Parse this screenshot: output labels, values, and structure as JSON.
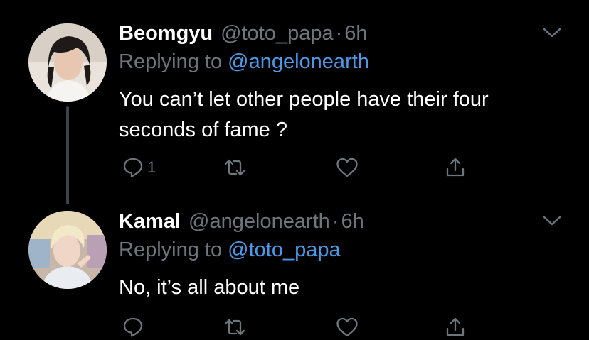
{
  "tweets": [
    {
      "author": {
        "name": "Beomgyu",
        "handle": "@toto_papa",
        "separator": "·",
        "time": "6h",
        "avatar_icon": "avatar-photo"
      },
      "replying_to": {
        "prefix": "Replying to",
        "mention": "@angelonearth"
      },
      "text": "You can’t let other people have their four seconds of fame ?",
      "actions": {
        "reply_count": "1",
        "retweet_count": "",
        "like_count": ""
      }
    },
    {
      "author": {
        "name": "Kamal",
        "handle": "@angelonearth",
        "separator": "·",
        "time": "6h",
        "avatar_icon": "avatar-photo"
      },
      "replying_to": {
        "prefix": "Replying to",
        "mention": "@toto_papa"
      },
      "text": "No, it’s all about me",
      "actions": {
        "reply_count": "",
        "retweet_count": "",
        "like_count": ""
      }
    }
  ],
  "colors": {
    "background": "#000000",
    "primary_text": "#ffffff",
    "secondary_text": "#6e767d",
    "mention": "#4a99e9",
    "thread_line": "#3d4148"
  },
  "icons": [
    "reply-icon",
    "retweet-icon",
    "like-icon",
    "share-icon",
    "chevron-down-icon"
  ]
}
